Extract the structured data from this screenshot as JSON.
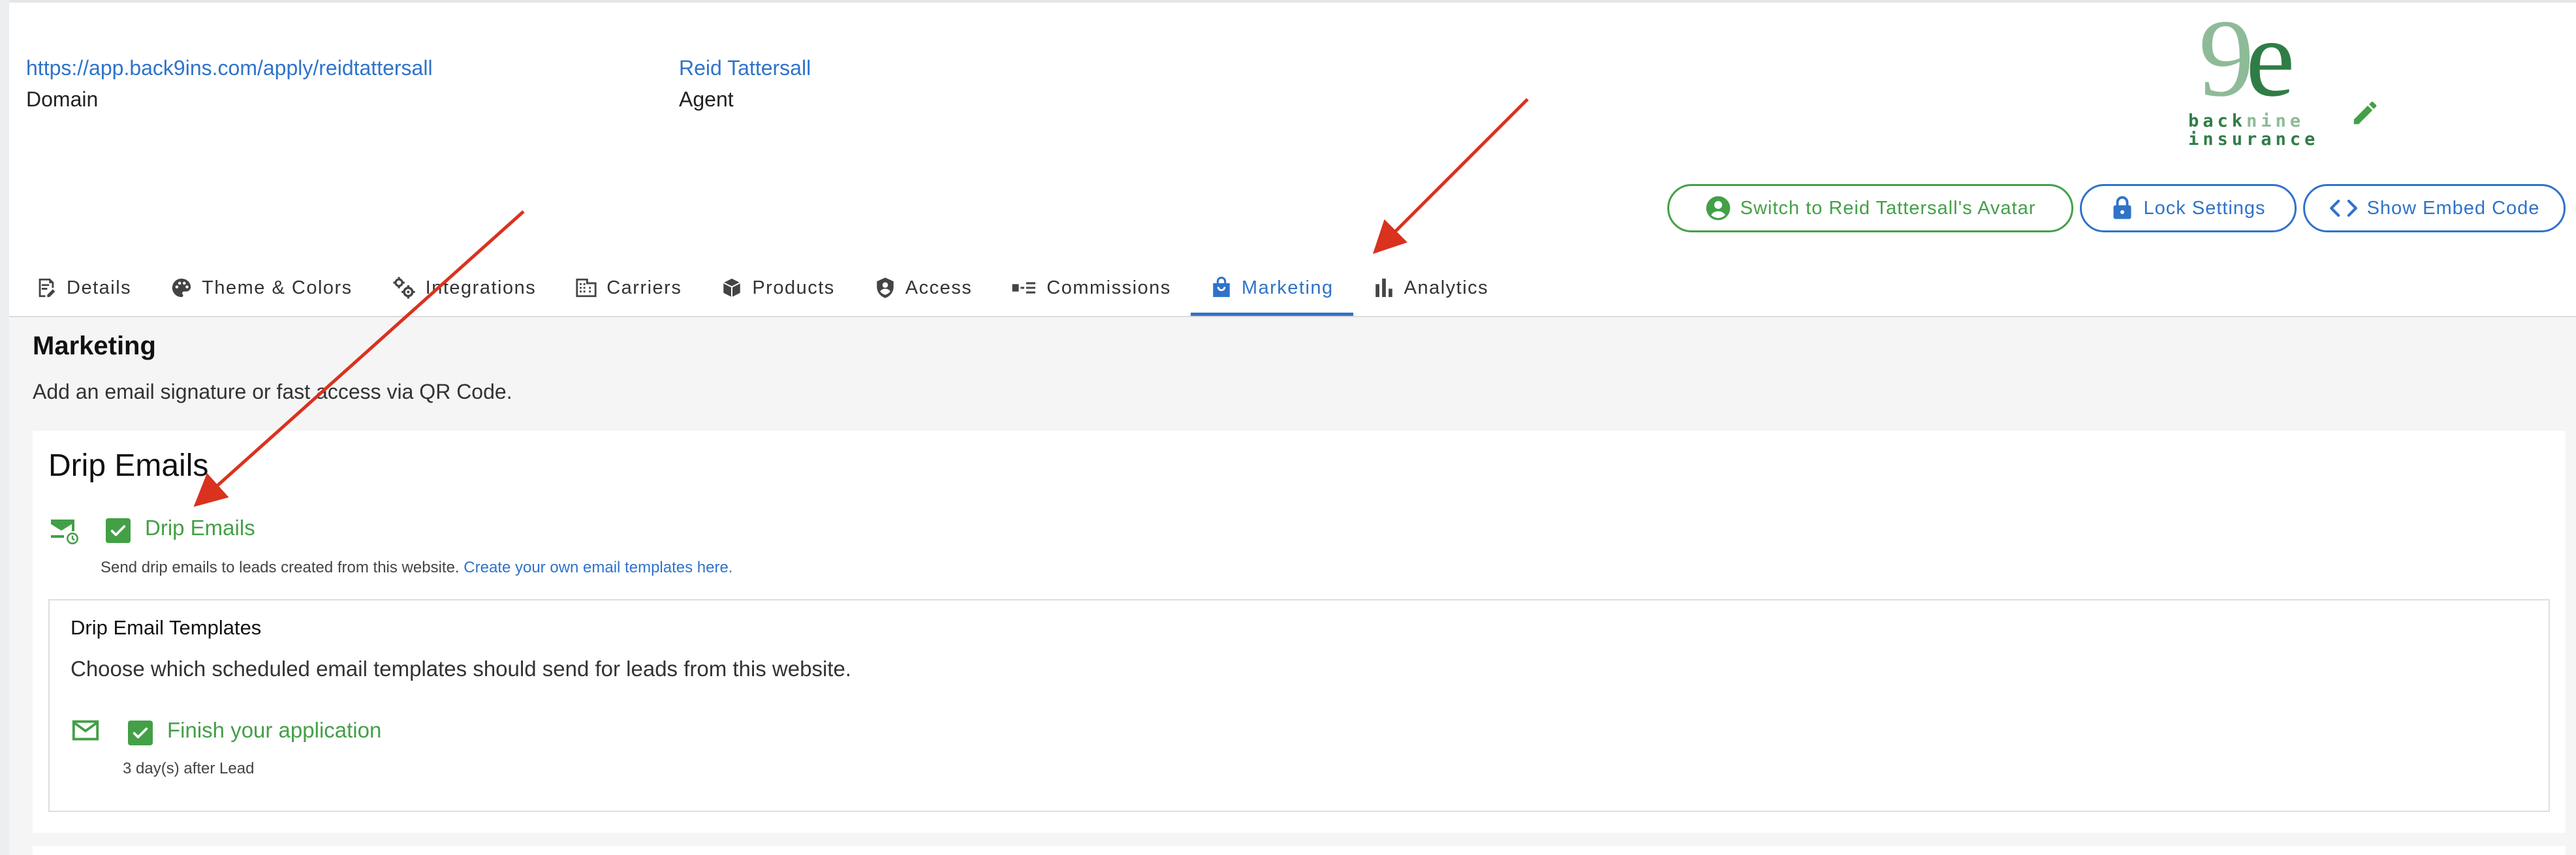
{
  "header": {
    "domain_url": "https://app.back9ins.com/apply/reidtattersall",
    "domain_label": "Domain",
    "agent_name": "Reid Tattersall",
    "agent_label": "Agent",
    "logo_text_light": "back",
    "logo_text_dark_1": "nine",
    "logo_text_bottom": "insurance",
    "edit_icon": "pencil-icon"
  },
  "actions": {
    "switch_avatar_label": "Switch to Reid Tattersall's Avatar",
    "lock_settings_label": "Lock Settings",
    "show_embed_label": "Show Embed Code"
  },
  "tabs": [
    {
      "label": "Details",
      "icon": "edit-document-icon"
    },
    {
      "label": "Theme & Colors",
      "icon": "palette-icon"
    },
    {
      "label": "Integrations",
      "icon": "gears-icon"
    },
    {
      "label": "Carriers",
      "icon": "building-icon"
    },
    {
      "label": "Products",
      "icon": "cube-icon"
    },
    {
      "label": "Access",
      "icon": "shield-user-icon"
    },
    {
      "label": "Commissions",
      "icon": "commission-icon"
    },
    {
      "label": "Marketing",
      "icon": "shopping-bag-icon",
      "active": true
    },
    {
      "label": "Analytics",
      "icon": "bar-chart-icon"
    }
  ],
  "marketing": {
    "title": "Marketing",
    "description": "Add an email signature or fast access via QR Code.",
    "drip": {
      "card_title": "Drip Emails",
      "toggle_label": "Drip Emails",
      "checked": true,
      "hint": "Send drip emails to leads created from this website.",
      "hint_link": "Create your own email templates here.",
      "templates_title": "Drip Email Templates",
      "templates_description": "Choose which scheduled email templates should send for leads from this website.",
      "templates": [
        {
          "label": "Finish your application",
          "schedule": "3 day(s) after Lead",
          "checked": true
        }
      ]
    }
  },
  "colors": {
    "accent_blue": "#2f73c9",
    "accent_green": "#43a047",
    "annotation_red": "#d9321f"
  }
}
